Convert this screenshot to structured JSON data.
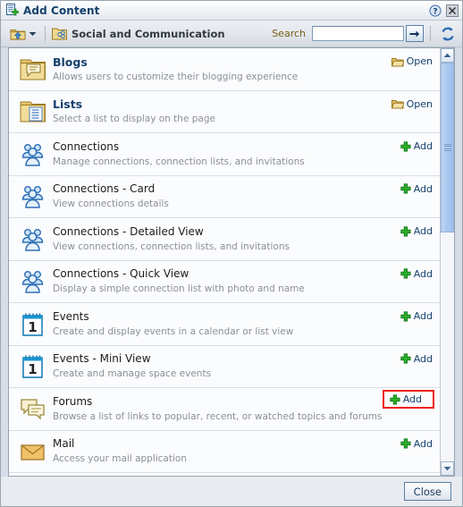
{
  "window": {
    "title": "Add Content",
    "title_icon": "add-content-icon",
    "help_icon": "help-icon",
    "close_icon": "close-icon"
  },
  "toolbar": {
    "up_icon": "folder-up-icon",
    "dropdown_icon": "chevron-down-icon",
    "breadcrumb_icon": "social-folder-icon",
    "breadcrumb_label": "Social and Communication",
    "search_label": "Search",
    "search_value": "",
    "search_placeholder": "",
    "go_icon": "arrow-right-icon",
    "refresh_icon": "refresh-icon"
  },
  "list": {
    "rows": [
      {
        "icon": "folder-blog-icon",
        "title": "Blogs",
        "desc": "Allows users to customize their blogging experience",
        "action": "Open",
        "action_icon": "open-folder-icon",
        "bold": true,
        "highlighted": false
      },
      {
        "icon": "folder-list-icon",
        "title": "Lists",
        "desc": "Select a list to display on the page",
        "action": "Open",
        "action_icon": "open-folder-icon",
        "bold": true,
        "highlighted": false
      },
      {
        "icon": "connections-icon",
        "title": "Connections",
        "desc": "Manage connections, connection lists, and invitations",
        "action": "Add",
        "action_icon": "plus-icon",
        "bold": false,
        "highlighted": false
      },
      {
        "icon": "connections-icon",
        "title": "Connections - Card",
        "desc": "View connections details",
        "action": "Add",
        "action_icon": "plus-icon",
        "bold": false,
        "highlighted": false
      },
      {
        "icon": "connections-icon",
        "title": "Connections - Detailed View",
        "desc": "View connections, connection lists, and invitations",
        "action": "Add",
        "action_icon": "plus-icon",
        "bold": false,
        "highlighted": false
      },
      {
        "icon": "connections-icon",
        "title": "Connections - Quick View",
        "desc": "Display a simple connection list with photo and name",
        "action": "Add",
        "action_icon": "plus-icon",
        "bold": false,
        "highlighted": false
      },
      {
        "icon": "calendar-icon",
        "title": "Events",
        "desc": "Create and display events in a calendar or list view",
        "action": "Add",
        "action_icon": "plus-icon",
        "bold": false,
        "highlighted": false
      },
      {
        "icon": "calendar-icon",
        "title": "Events - Mini View",
        "desc": "Create and manage space events",
        "action": "Add",
        "action_icon": "plus-icon",
        "bold": false,
        "highlighted": false
      },
      {
        "icon": "forums-icon",
        "title": "Forums",
        "desc": "Browse a list of links to popular, recent, or watched topics and forums",
        "action": "Add",
        "action_icon": "plus-icon",
        "bold": false,
        "highlighted": true
      },
      {
        "icon": "mail-icon",
        "title": "Mail",
        "desc": "Access your mail application",
        "action": "Add",
        "action_icon": "plus-icon",
        "bold": false,
        "highlighted": false
      }
    ]
  },
  "scrollbar": {
    "up_icon": "chevron-up-icon",
    "down_icon": "chevron-down-icon"
  },
  "footer": {
    "close_label": "Close"
  },
  "colors": {
    "accent": "#15406b",
    "highlight": "#ee1b15",
    "add_green": "#2aa02a",
    "folder_gold": "#e3b84f"
  }
}
